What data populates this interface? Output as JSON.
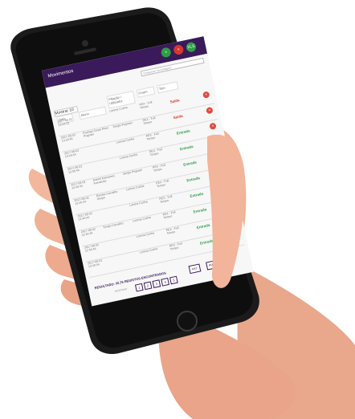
{
  "app": {
    "title": "Movimentos"
  },
  "header_buttons": [
    {
      "label": ">",
      "icon": "forward-icon"
    },
    {
      "label": "<",
      "icon": "back-icon"
    },
    {
      "label": "XLS",
      "icon": "excel-icon"
    }
  ],
  "search": {
    "placeholder": "Pesquisar na Listagem"
  },
  "mostrar": {
    "label": "Mostrar 10"
  },
  "columns": [
    "Data",
    "Aluno",
    "Filiação / Utilizador",
    "Grupo",
    "Tipo"
  ],
  "rows": [
    {
      "date": "2017-08-02 13:44:22",
      "aluno": "",
      "filiacao": "Lorena Cunha",
      "grupo": "PEX - Full Tempo",
      "tipo": "Saída"
    },
    {
      "date": "2017-08-02 13:18:46",
      "aluno": "Rodrigo Cesar Pires Pugnani",
      "filiacao": "Sergio Pugnani",
      "grupo": "PEX - Full Tempo",
      "tipo": "Saída"
    },
    {
      "date": "2017-08-02 13:16:44",
      "aluno": "",
      "filiacao": "Lorena Cunha",
      "grupo": "PEX - Full Tempo",
      "tipo": "Entrada"
    },
    {
      "date": "2017-08-02 12:56:44",
      "aluno": "",
      "filiacao": "Lorena Cunha",
      "grupo": "PEX - Full Tempo",
      "tipo": "Entrada"
    },
    {
      "date": "2017-08-02 12:40:44",
      "aluno": "Daniel Kamanesi Kowaszky",
      "filiacao": "Sergio Pugnani",
      "grupo": "PEX - Full Tempo",
      "tipo": "Entrada"
    },
    {
      "date": "2017-08-02 12:40:44",
      "aluno": "Renata Carvalho Sergio",
      "filiacao": "Lorena Cunha",
      "grupo": "PEX - Full Tempo",
      "tipo": "Entrada"
    },
    {
      "date": "2017-08-02 12:40:44",
      "aluno": "",
      "filiacao": "Lorena Cunha",
      "grupo": "PEX - Full Tempo",
      "tipo": "Entrada"
    },
    {
      "date": "2017-08-02 12:40:44",
      "aluno": "Sergio Carvalho",
      "filiacao": "Lorena Cunha",
      "grupo": "PEX - Full Tempo",
      "tipo": "Entrada"
    },
    {
      "date": "2017-08-02 12:40:44",
      "aluno": "",
      "filiacao": "Lorena Cunha",
      "grupo": "PEX - Full Tempo",
      "tipo": "Entrada"
    },
    {
      "date": "2017-08-02 12:40:44",
      "aluno": "",
      "filiacao": "Lorena Cunha",
      "grupo": "PEX - Full Tempo",
      "tipo": "Entrada"
    }
  ],
  "footer": {
    "result": "RESULTADO: 50,76 REGISTOS ENCONTRADOS",
    "mostrar_label": "MOSTRAR",
    "pages": [
      "1",
      "2",
      "3",
      "4",
      "5"
    ],
    "prev": "ANT.",
    "next": "PRÓXIMO"
  },
  "colors": {
    "appbar": "#3a1a5a",
    "saida": "#d8372d",
    "entrada": "#2e9e45"
  }
}
